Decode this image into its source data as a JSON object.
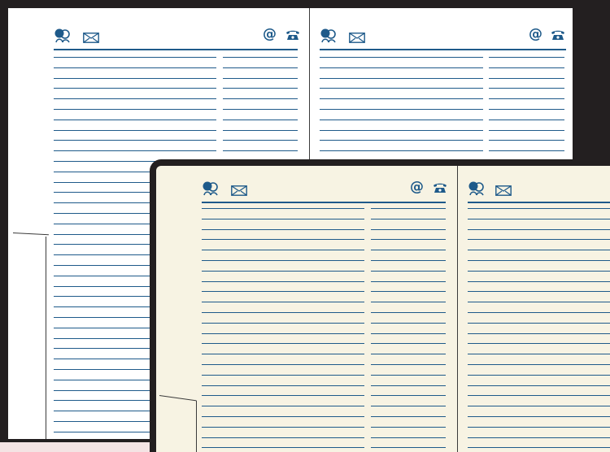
{
  "colors": {
    "ink": "#1e5a8a",
    "cover": "#231f20",
    "paper_white": "#ffffff",
    "paper_cream": "#f7f3e3",
    "background": "#f4e4e4"
  },
  "header_icons": {
    "left": [
      "people-icon",
      "envelope-icon"
    ],
    "right": [
      "at-sign-icon",
      "telephone-icon"
    ],
    "at_glyph": "@",
    "phone_glyph": "☎",
    "mail_glyph": "✉",
    "people_glyph": "👥"
  },
  "books": [
    {
      "name": "white-notebook",
      "paper": "white"
    },
    {
      "name": "cream-notebook",
      "paper": "cream"
    }
  ]
}
